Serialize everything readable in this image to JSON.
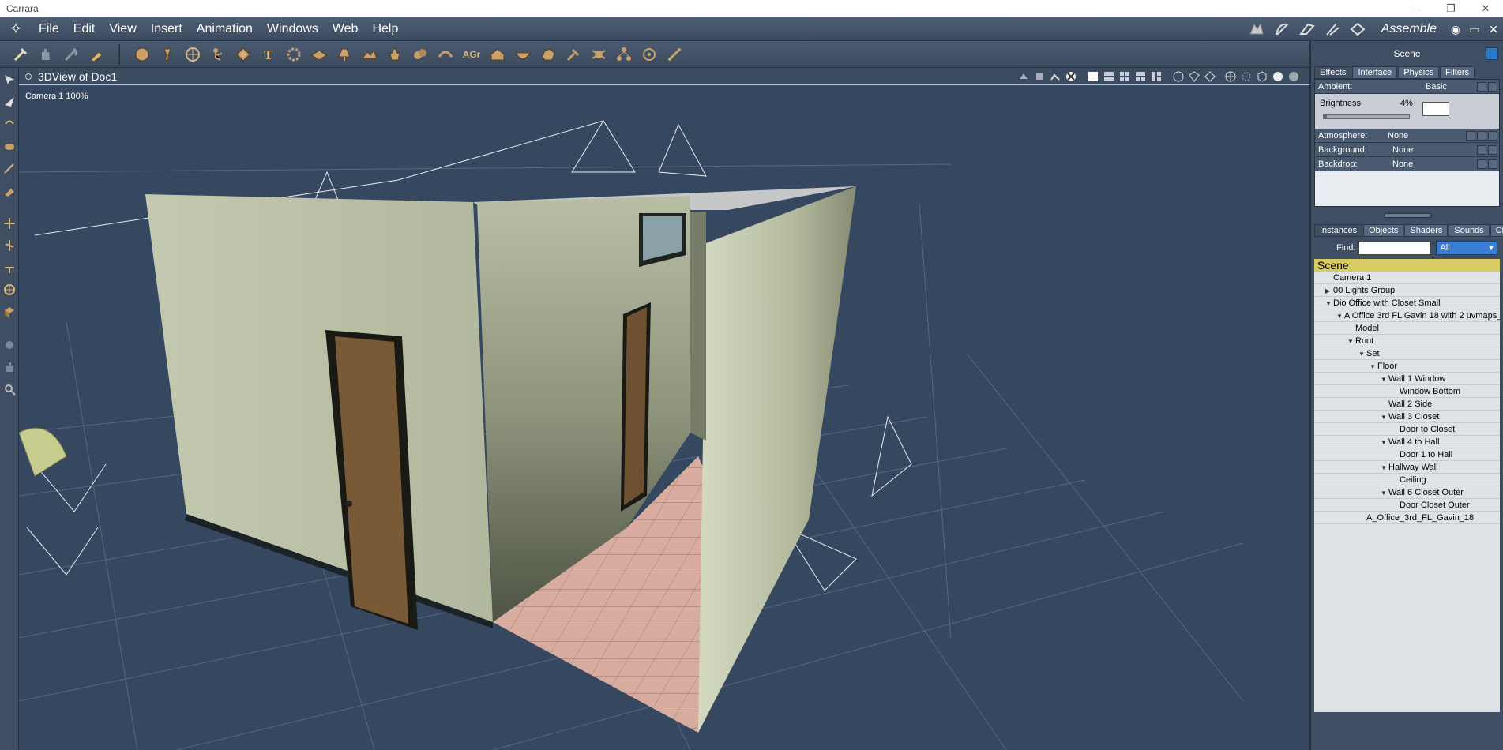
{
  "window": {
    "title": "Carrara",
    "minimize": "—",
    "maximize": "❐",
    "close": "✕"
  },
  "menu": {
    "items": [
      "File",
      "Edit",
      "View",
      "Insert",
      "Animation",
      "Windows",
      "Web",
      "Help"
    ]
  },
  "room": {
    "label": "Assemble",
    "win_controls": [
      "◉",
      "▭",
      "✕"
    ]
  },
  "toolbar": {
    "icons": [
      "select-tool-icon",
      "hand-tool-icon",
      "animate-tool-icon",
      "paint-tool-icon",
      "sphere-icon",
      "cone-icon",
      "globe-icon",
      "figure-icon",
      "light-icon",
      "text-icon",
      "gear-icon",
      "plane-icon",
      "spot-light-icon",
      "terrain-icon",
      "hand-icon",
      "metaball-icon",
      "spline-icon",
      "agr-icon",
      "house-icon",
      "bowl-icon",
      "rock-icon",
      "pin-icon",
      "bug-icon",
      "hierarchy-icon",
      "target-icon",
      "bone-icon"
    ],
    "agr_text": "AGr"
  },
  "viewport": {
    "title": "3DView of Doc1",
    "camera_label": "Camera 1 100%"
  },
  "scene_panel": {
    "header": "Scene",
    "tabs": [
      "Effects",
      "Interface",
      "Physics",
      "Filters"
    ],
    "ambient": {
      "label": "Ambient:",
      "value": "Basic"
    },
    "brightness": {
      "label": "Brightness",
      "value": "4%",
      "level": 0.04
    },
    "atmosphere": {
      "label": "Atmosphere:",
      "value": "None"
    },
    "background": {
      "label": "Background:",
      "value": "None"
    },
    "backdrop": {
      "label": "Backdrop:",
      "value": "None"
    }
  },
  "browser": {
    "tabs": [
      "Instances",
      "Objects",
      "Shaders",
      "Sounds",
      "Clips"
    ],
    "find_label": "Find:",
    "find_value": "",
    "filter": "All",
    "root": "Scene",
    "nodes": [
      {
        "label": "Camera 1",
        "depth": 0,
        "tri": ""
      },
      {
        "label": "00 Lights Group",
        "depth": 0,
        "tri": "▶"
      },
      {
        "label": "Dio Office with Closet Small",
        "depth": 0,
        "tri": "▼"
      },
      {
        "label": "A Office 3rd FL Gavin 18 with 2 uvmaps_",
        "depth": 1,
        "tri": "▼"
      },
      {
        "label": "Model",
        "depth": 2,
        "tri": ""
      },
      {
        "label": "Root",
        "depth": 2,
        "tri": "▼"
      },
      {
        "label": "Set",
        "depth": 3,
        "tri": "▼"
      },
      {
        "label": "Floor",
        "depth": 4,
        "tri": "▼"
      },
      {
        "label": "Wall 1 Window",
        "depth": 5,
        "tri": "▼"
      },
      {
        "label": "Window Bottom",
        "depth": 6,
        "tri": ""
      },
      {
        "label": "Wall 2 Side",
        "depth": 5,
        "tri": ""
      },
      {
        "label": "Wall 3 Closet",
        "depth": 5,
        "tri": "▼"
      },
      {
        "label": "Door to Closet",
        "depth": 6,
        "tri": ""
      },
      {
        "label": "Wall 4 to Hall",
        "depth": 5,
        "tri": "▼"
      },
      {
        "label": "Door 1 to Hall",
        "depth": 6,
        "tri": ""
      },
      {
        "label": "Hallway Wall",
        "depth": 5,
        "tri": "▼"
      },
      {
        "label": "Ceiling",
        "depth": 6,
        "tri": ""
      },
      {
        "label": "Wall 6 Closet Outer",
        "depth": 5,
        "tri": "▼"
      },
      {
        "label": "Door Closet Outer",
        "depth": 6,
        "tri": ""
      },
      {
        "label": "A_Office_3rd_FL_Gavin_18",
        "depth": 3,
        "tri": ""
      }
    ]
  }
}
